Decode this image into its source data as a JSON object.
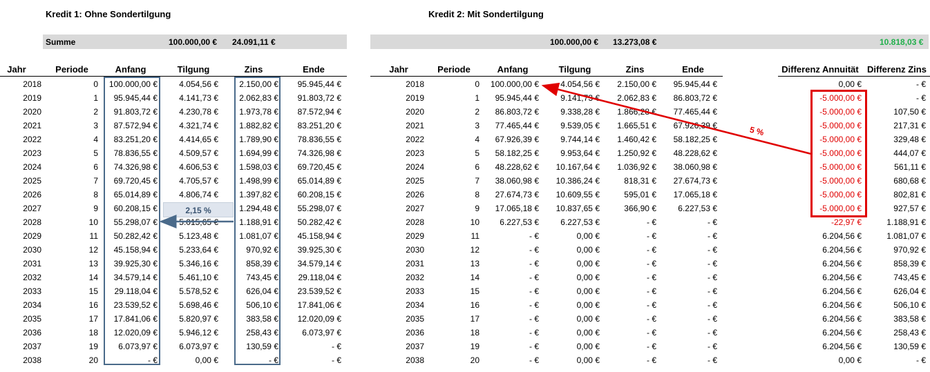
{
  "kredit1": {
    "title": "Kredit 1: Ohne Sondertilgung"
  },
  "kredit2": {
    "title": "Kredit 2: Mit Sondertilgung"
  },
  "summary": {
    "label": "Summe",
    "k1_anfang": "100.000,00 €",
    "k1_zins": "24.091,11 €",
    "k2_anfang": "100.000,00 €",
    "k2_zins": "13.273,08 €",
    "differenz": "10.818,03 €",
    "differenz_color": "#21b04b"
  },
  "headers": {
    "k1": [
      "Jahr",
      "Periode",
      "Anfang",
      "Tilgung",
      "Zins",
      "Ende"
    ],
    "k2": [
      "Jahr",
      "Periode",
      "Anfang",
      "Tilgung",
      "Zins",
      "Ende"
    ],
    "diff": [
      "Differenz Annuität",
      "Differenz Zins"
    ]
  },
  "annotations": {
    "callout_rate": "2,15 %",
    "arrow_rate": "5 %",
    "highlight_color": "#e00000",
    "box_color": "#4a6a8a"
  },
  "rows": [
    {
      "jahr": "2018",
      "periode": "0",
      "a1": "100.000,00 €",
      "t1": "4.054,56 €",
      "z1": "2.150,00 €",
      "e1": "95.945,44 €",
      "jahr2": "2018",
      "periode2": "0",
      "a2": "100.000,00 €",
      "t2": "4.054,56 €",
      "z2": "2.150,00 €",
      "e2": "95.945,44 €",
      "da": "0,00 €",
      "dz": "-   €",
      "neg": false
    },
    {
      "jahr": "2019",
      "periode": "1",
      "a1": "95.945,44 €",
      "t1": "4.141,73 €",
      "z1": "2.062,83 €",
      "e1": "91.803,72 €",
      "jahr2": "2019",
      "periode2": "1",
      "a2": "95.945,44 €",
      "t2": "9.141,73 €",
      "z2": "2.062,83 €",
      "e2": "86.803,72 €",
      "da": "-5.000,00 €",
      "dz": "-   €",
      "neg": true
    },
    {
      "jahr": "2020",
      "periode": "2",
      "a1": "91.803,72 €",
      "t1": "4.230,78 €",
      "z1": "1.973,78 €",
      "e1": "87.572,94 €",
      "jahr2": "2020",
      "periode2": "2",
      "a2": "86.803,72 €",
      "t2": "9.338,28 €",
      "z2": "1.866,28 €",
      "e2": "77.465,44 €",
      "da": "-5.000,00 €",
      "dz": "107,50 €",
      "neg": true
    },
    {
      "jahr": "2021",
      "periode": "3",
      "a1": "87.572,94 €",
      "t1": "4.321,74 €",
      "z1": "1.882,82 €",
      "e1": "83.251,20 €",
      "jahr2": "2021",
      "periode2": "3",
      "a2": "77.465,44 €",
      "t2": "9.539,05 €",
      "z2": "1.665,51 €",
      "e2": "67.926,39 €",
      "da": "-5.000,00 €",
      "dz": "217,31 €",
      "neg": true
    },
    {
      "jahr": "2022",
      "periode": "4",
      "a1": "83.251,20 €",
      "t1": "4.414,65 €",
      "z1": "1.789,90 €",
      "e1": "78.836,55 €",
      "jahr2": "2022",
      "periode2": "4",
      "a2": "67.926,39 €",
      "t2": "9.744,14 €",
      "z2": "1.460,42 €",
      "e2": "58.182,25 €",
      "da": "-5.000,00 €",
      "dz": "329,48 €",
      "neg": true
    },
    {
      "jahr": "2023",
      "periode": "5",
      "a1": "78.836,55 €",
      "t1": "4.509,57 €",
      "z1": "1.694,99 €",
      "e1": "74.326,98 €",
      "jahr2": "2023",
      "periode2": "5",
      "a2": "58.182,25 €",
      "t2": "9.953,64 €",
      "z2": "1.250,92 €",
      "e2": "48.228,62 €",
      "da": "-5.000,00 €",
      "dz": "444,07 €",
      "neg": true
    },
    {
      "jahr": "2024",
      "periode": "6",
      "a1": "74.326,98 €",
      "t1": "4.606,53 €",
      "z1": "1.598,03 €",
      "e1": "69.720,45 €",
      "jahr2": "2024",
      "periode2": "6",
      "a2": "48.228,62 €",
      "t2": "10.167,64 €",
      "z2": "1.036,92 €",
      "e2": "38.060,98 €",
      "da": "-5.000,00 €",
      "dz": "561,11 €",
      "neg": true
    },
    {
      "jahr": "2025",
      "periode": "7",
      "a1": "69.720,45 €",
      "t1": "4.705,57 €",
      "z1": "1.498,99 €",
      "e1": "65.014,89 €",
      "jahr2": "2025",
      "periode2": "7",
      "a2": "38.060,98 €",
      "t2": "10.386,24 €",
      "z2": "818,31 €",
      "e2": "27.674,73 €",
      "da": "-5.000,00 €",
      "dz": "680,68 €",
      "neg": true
    },
    {
      "jahr": "2026",
      "periode": "8",
      "a1": "65.014,89 €",
      "t1": "4.806,74 €",
      "z1": "1.397,82 €",
      "e1": "60.208,15 €",
      "jahr2": "2026",
      "periode2": "8",
      "a2": "27.674,73 €",
      "t2": "10.609,55 €",
      "z2": "595,01 €",
      "e2": "17.065,18 €",
      "da": "-5.000,00 €",
      "dz": "802,81 €",
      "neg": true
    },
    {
      "jahr": "2027",
      "periode": "9",
      "a1": "60.208,15 €",
      "t1": "4.909,58 €",
      "z1": "1.294,48 €",
      "e1": "55.298,07 €",
      "jahr2": "2027",
      "periode2": "9",
      "a2": "17.065,18 €",
      "t2": "10.837,65 €",
      "z2": "366,90 €",
      "e2": "6.227,53 €",
      "da": "-5.000,00 €",
      "dz": "927,57 €",
      "neg": true
    },
    {
      "jahr": "2028",
      "periode": "10",
      "a1": "55.298,07 €",
      "t1": "5.015,65 €",
      "z1": "1.188,91 €",
      "e1": "50.282,42 €",
      "jahr2": "2028",
      "periode2": "10",
      "a2": "6.227,53 €",
      "t2": "6.227,53 €",
      "z2": "-   €",
      "e2": "-   €",
      "da": "-22,97 €",
      "dz": "1.188,91 €",
      "neg": true
    },
    {
      "jahr": "2029",
      "periode": "11",
      "a1": "50.282,42 €",
      "t1": "5.123,48 €",
      "z1": "1.081,07 €",
      "e1": "45.158,94 €",
      "jahr2": "2029",
      "periode2": "11",
      "a2": "-   €",
      "t2": "0,00 €",
      "z2": "-   €",
      "e2": "-   €",
      "da": "6.204,56 €",
      "dz": "1.081,07 €",
      "neg": false
    },
    {
      "jahr": "2030",
      "periode": "12",
      "a1": "45.158,94 €",
      "t1": "5.233,64 €",
      "z1": "970,92 €",
      "e1": "39.925,30 €",
      "jahr2": "2030",
      "periode2": "12",
      "a2": "-   €",
      "t2": "0,00 €",
      "z2": "-   €",
      "e2": "-   €",
      "da": "6.204,56 €",
      "dz": "970,92 €",
      "neg": false
    },
    {
      "jahr": "2031",
      "periode": "13",
      "a1": "39.925,30 €",
      "t1": "5.346,16 €",
      "z1": "858,39 €",
      "e1": "34.579,14 €",
      "jahr2": "2031",
      "periode2": "13",
      "a2": "-   €",
      "t2": "0,00 €",
      "z2": "-   €",
      "e2": "-   €",
      "da": "6.204,56 €",
      "dz": "858,39 €",
      "neg": false
    },
    {
      "jahr": "2032",
      "periode": "14",
      "a1": "34.579,14 €",
      "t1": "5.461,10 €",
      "z1": "743,45 €",
      "e1": "29.118,04 €",
      "jahr2": "2032",
      "periode2": "14",
      "a2": "-   €",
      "t2": "0,00 €",
      "z2": "-   €",
      "e2": "-   €",
      "da": "6.204,56 €",
      "dz": "743,45 €",
      "neg": false
    },
    {
      "jahr": "2033",
      "periode": "15",
      "a1": "29.118,04 €",
      "t1": "5.578,52 €",
      "z1": "626,04 €",
      "e1": "23.539,52 €",
      "jahr2": "2033",
      "periode2": "15",
      "a2": "-   €",
      "t2": "0,00 €",
      "z2": "-   €",
      "e2": "-   €",
      "da": "6.204,56 €",
      "dz": "626,04 €",
      "neg": false
    },
    {
      "jahr": "2034",
      "periode": "16",
      "a1": "23.539,52 €",
      "t1": "5.698,46 €",
      "z1": "506,10 €",
      "e1": "17.841,06 €",
      "jahr2": "2034",
      "periode2": "16",
      "a2": "-   €",
      "t2": "0,00 €",
      "z2": "-   €",
      "e2": "-   €",
      "da": "6.204,56 €",
      "dz": "506,10 €",
      "neg": false
    },
    {
      "jahr": "2035",
      "periode": "17",
      "a1": "17.841,06 €",
      "t1": "5.820,97 €",
      "z1": "383,58 €",
      "e1": "12.020,09 €",
      "jahr2": "2035",
      "periode2": "17",
      "a2": "-   €",
      "t2": "0,00 €",
      "z2": "-   €",
      "e2": "-   €",
      "da": "6.204,56 €",
      "dz": "383,58 €",
      "neg": false
    },
    {
      "jahr": "2036",
      "periode": "18",
      "a1": "12.020,09 €",
      "t1": "5.946,12 €",
      "z1": "258,43 €",
      "e1": "6.073,97 €",
      "jahr2": "2036",
      "periode2": "18",
      "a2": "-   €",
      "t2": "0,00 €",
      "z2": "-   €",
      "e2": "-   €",
      "da": "6.204,56 €",
      "dz": "258,43 €",
      "neg": false
    },
    {
      "jahr": "2037",
      "periode": "19",
      "a1": "6.073,97 €",
      "t1": "6.073,97 €",
      "z1": "130,59 €",
      "e1": "-   €",
      "jahr2": "2037",
      "periode2": "19",
      "a2": "-   €",
      "t2": "0,00 €",
      "z2": "-   €",
      "e2": "-   €",
      "da": "6.204,56 €",
      "dz": "130,59 €",
      "neg": false
    },
    {
      "jahr": "2038",
      "periode": "20",
      "a1": "-   €",
      "t1": "0,00 €",
      "z1": "-   €",
      "e1": "-   €",
      "jahr2": "2038",
      "periode2": "20",
      "a2": "-   €",
      "t2": "0,00 €",
      "z2": "-   €",
      "e2": "-   €",
      "da": "0,00 €",
      "dz": "-   €",
      "neg": false
    }
  ]
}
